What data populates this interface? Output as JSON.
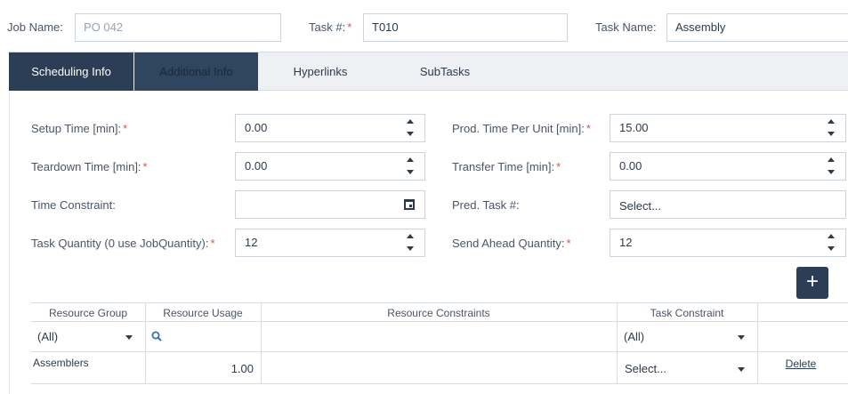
{
  "header": {
    "job_name_label": "Job Name:",
    "job_name_value": "PO 042",
    "task_num_label": "Task #:",
    "task_num_value": "T010",
    "task_name_label": "Task Name:",
    "task_name_value": "Assembly",
    "required_mark": "*"
  },
  "tabs": [
    {
      "label": "Scheduling Info",
      "active": true
    },
    {
      "label": "Additional Info",
      "active": false
    },
    {
      "label": "Hyperlinks",
      "active": false
    },
    {
      "label": "SubTasks",
      "active": false
    }
  ],
  "form": {
    "setup_time_label": "Setup Time [min]:",
    "setup_time_value": "0.00",
    "teardown_time_label": "Teardown Time [min]:",
    "teardown_time_value": "0.00",
    "time_constraint_label": "Time Constraint:",
    "time_constraint_value": "",
    "task_quantity_label": "Task Quantity (0 use JobQuantity):",
    "task_quantity_value": "12",
    "prod_time_label": "Prod. Time Per Unit [min]:",
    "prod_time_value": "15.00",
    "transfer_time_label": "Transfer Time [min]:",
    "transfer_time_value": "0.00",
    "pred_task_label": "Pred. Task #:",
    "pred_task_placeholder": "Select...",
    "send_ahead_label": "Send Ahead Quantity:",
    "send_ahead_value": "12",
    "add_label": "+"
  },
  "grid": {
    "columns": [
      "Resource Group",
      "Resource Usage",
      "Resource Constraints",
      "Task Constraint"
    ],
    "filter": {
      "resource_group": "(All)",
      "task_constraint": "(All)"
    },
    "rows": [
      {
        "resource_group": "Assemblers",
        "resource_usage": "1.00",
        "resource_constraints": "",
        "task_constraint": "Select...",
        "action": "Delete"
      }
    ]
  },
  "colors": {
    "accent": "#2b3e55",
    "required": "#d9534f",
    "border": "#ccd3da"
  }
}
